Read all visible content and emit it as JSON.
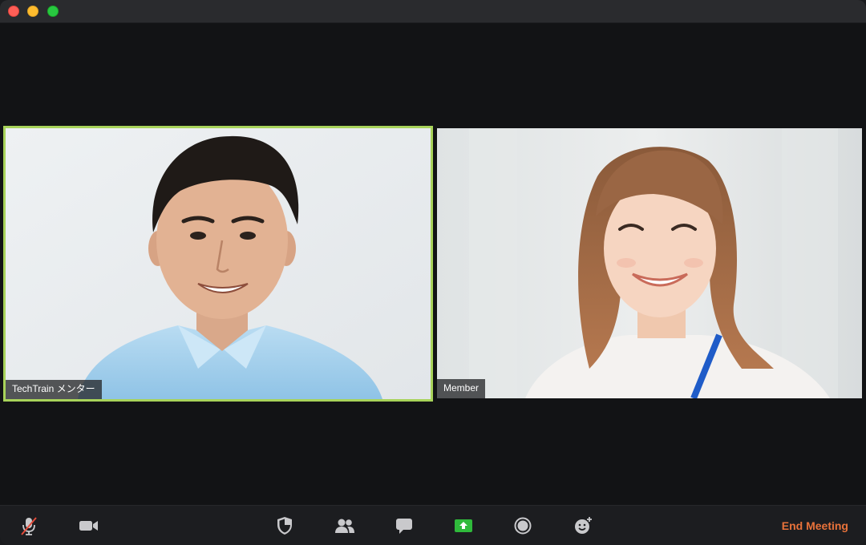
{
  "window": {
    "controls": [
      "close",
      "minimize",
      "zoom"
    ]
  },
  "participants": [
    {
      "name": "TechTrain メンター",
      "active_speaker": true,
      "highlight_color": "#a8d35a"
    },
    {
      "name": "Member",
      "active_speaker": false
    }
  ],
  "toolbar": {
    "buttons": [
      {
        "icon": "microphone-muted-icon"
      },
      {
        "icon": "video-camera-icon"
      },
      {
        "icon": "security-shield-icon"
      },
      {
        "icon": "participants-icon"
      },
      {
        "icon": "chat-icon"
      },
      {
        "icon": "share-screen-icon",
        "accent": "#2fba3b"
      },
      {
        "icon": "record-icon"
      },
      {
        "icon": "reactions-icon"
      }
    ],
    "end_meeting_label": "End Meeting",
    "end_meeting_color": "#e8723a"
  }
}
